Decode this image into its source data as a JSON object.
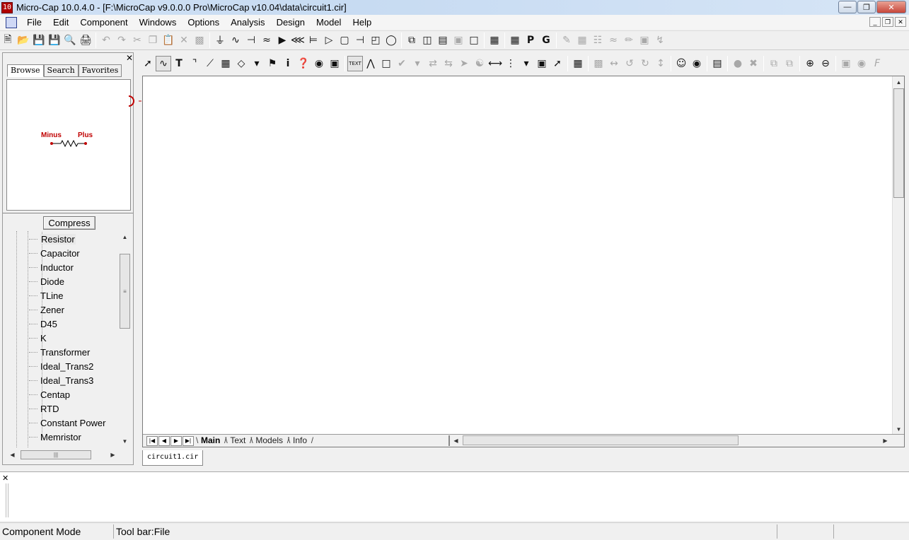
{
  "window": {
    "title": "Micro-Cap 10.0.4.0 - [F:\\MicroCap v9.0.0.0 Pro\\MicroCap v10.04\\data\\circuit1.cir]",
    "app_icon_text": "10"
  },
  "menu": [
    "File",
    "Edit",
    "Component",
    "Windows",
    "Options",
    "Analysis",
    "Design",
    "Model",
    "Help"
  ],
  "left_panel": {
    "tabs": [
      "Browse",
      "Search",
      "Favorites"
    ],
    "active_tab": "Browse",
    "preview": {
      "pin_minus": "Minus",
      "pin_plus": "Plus"
    },
    "compress_label": "Compress",
    "tree_items": [
      "Resistor",
      "Capacitor",
      "Inductor",
      "Diode",
      "TLine",
      "Zener",
      "D45",
      "K",
      "Transformer",
      "Ideal_Trans2",
      "Ideal_Trans3",
      "Centap",
      "RTD",
      "Constant Power",
      "Memristor"
    ],
    "tree_selected": "Resistor"
  },
  "schematic": {
    "page_tabs": [
      "Main",
      "Text",
      "Models",
      "Info"
    ],
    "active_page": "Main",
    "document_tab": "circuit1.cir"
  },
  "status": {
    "mode": "Component Mode",
    "hint": "Tool bar:File"
  },
  "colors": {
    "component_red": "#c00000",
    "titlebar": "#c7dbf2"
  }
}
